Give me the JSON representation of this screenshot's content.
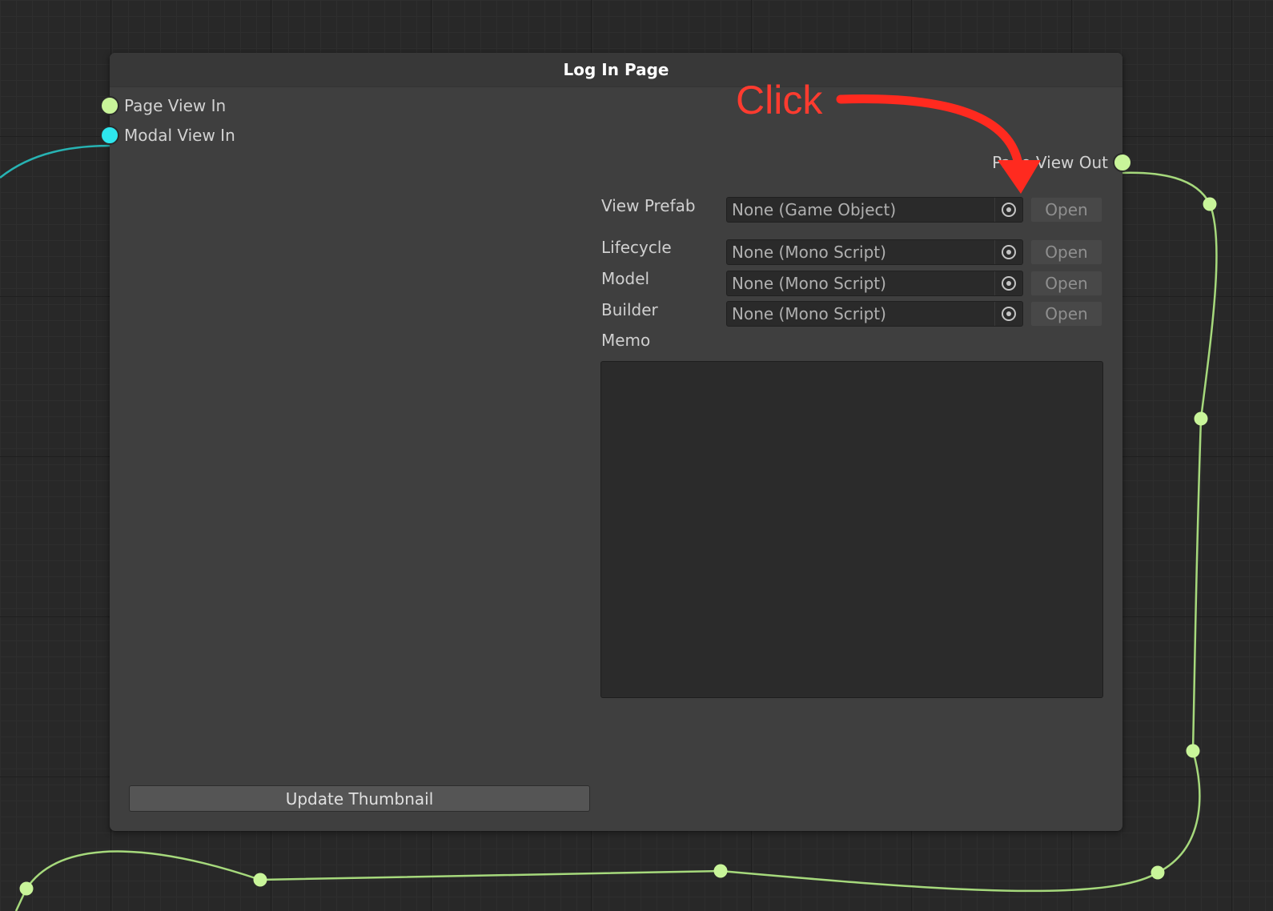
{
  "node": {
    "title": "Log In Page",
    "inputs": [
      {
        "label": "Page View In",
        "color": "#c9f59a"
      },
      {
        "label": "Modal View In",
        "color": "#2ee6ee"
      }
    ],
    "outputs": [
      {
        "label": "Page View Out",
        "color": "#c9f59a"
      }
    ],
    "fields": [
      {
        "label": "View Prefab",
        "value": "None (Game Object)",
        "button": "Open"
      },
      {
        "label": "Lifecycle",
        "value": "None (Mono Script)",
        "button": "Open"
      },
      {
        "label": "Model",
        "value": "None (Mono Script)",
        "button": "Open"
      },
      {
        "label": "Builder",
        "value": "None (Mono Script)",
        "button": "Open"
      }
    ],
    "memo": {
      "label": "Memo",
      "value": ""
    },
    "update_button": "Update Thumbnail"
  },
  "annotation": {
    "text": "Click",
    "color": "#ff3b2f"
  },
  "edge_colors": {
    "page": "#a6d97c",
    "modal": "#27b3b3",
    "reroute": "#c9f59a"
  }
}
